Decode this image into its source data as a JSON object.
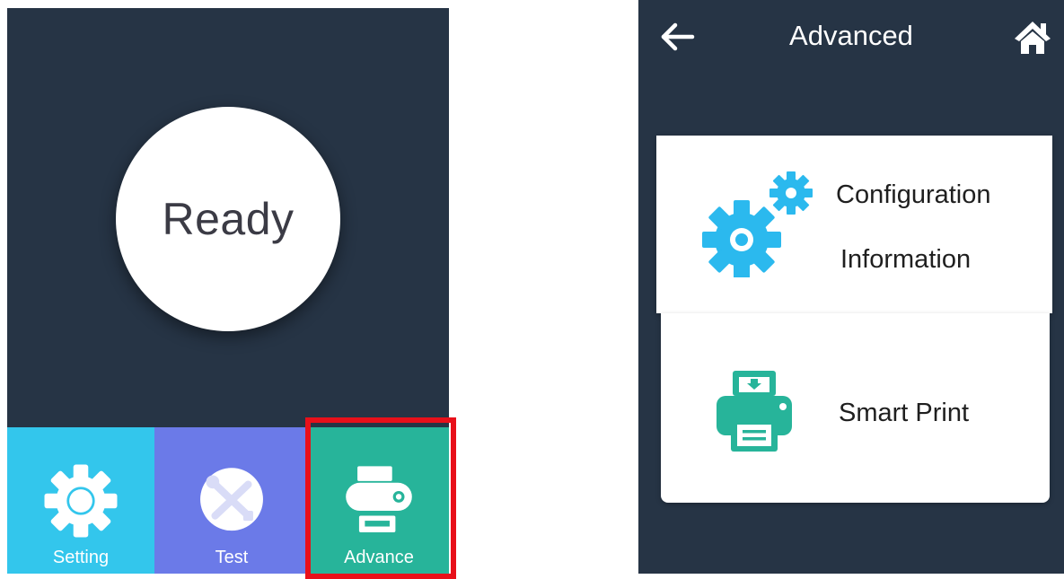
{
  "home_screen": {
    "status_text": "Ready",
    "tabs": [
      {
        "label": "Setting",
        "icon": "gear-icon",
        "color": "#33c6ec"
      },
      {
        "label": "Test",
        "icon": "tools-icon",
        "color": "#6b7ae8"
      },
      {
        "label": "Advance",
        "icon": "printer-icon",
        "color": "#27b49a"
      }
    ],
    "highlight_color": "#e8101a"
  },
  "advanced_screen": {
    "title": "Advanced",
    "back_icon": "back-arrow-icon",
    "home_icon": "home-icon",
    "items": [
      {
        "label_line1": "Configuration",
        "label_line2": "Information",
        "icon": "gears-icon",
        "icon_color": "#2bb9ee"
      },
      {
        "label": "Smart Print",
        "icon": "printer-icon",
        "icon_color": "#27b49a"
      }
    ]
  },
  "colors": {
    "panel_bg": "#263445",
    "card_bg": "#ffffff"
  }
}
